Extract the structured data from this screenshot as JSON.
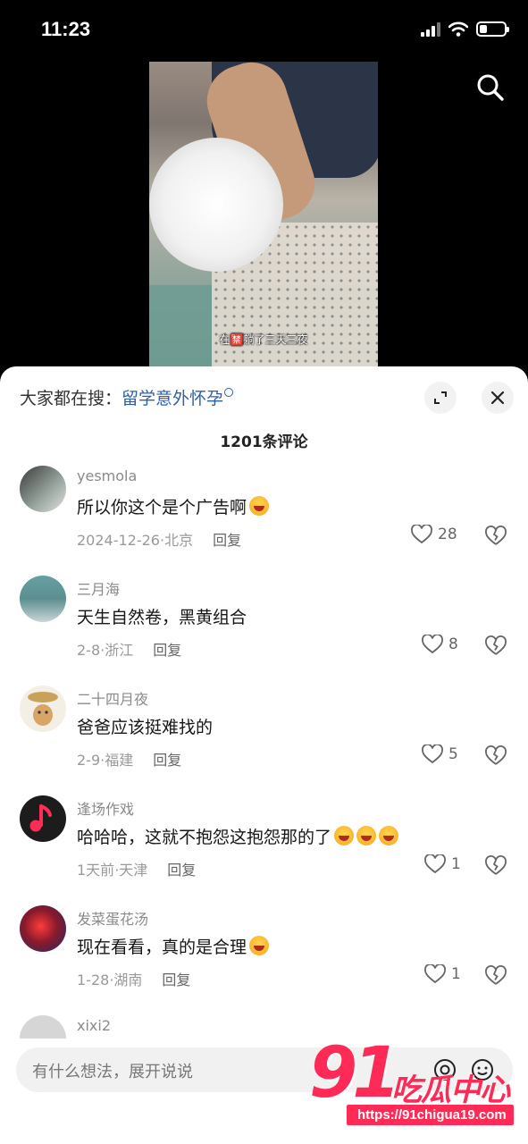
{
  "status_bar": {
    "time": "11:23",
    "battery_level": 0.3
  },
  "video": {
    "caption": "在🈲躺了三天三夜"
  },
  "comments_panel": {
    "search_prefix": "大家都在搜：",
    "search_term": "留学意外怀孕",
    "count_label": "1201条评论",
    "reply_label": "回复",
    "comments": [
      {
        "user": "yesmola",
        "text": "所以你这个是个广告啊",
        "emoji": "😂",
        "date": "2024-12-26",
        "location": "北京",
        "likes": "28"
      },
      {
        "user": "三月海",
        "text": "天生自然卷，黑黄组合",
        "emoji": "",
        "date": "2-8",
        "location": "浙江",
        "likes": "8"
      },
      {
        "user": "二十四月夜",
        "text": "爸爸应该挺难找的",
        "emoji": "",
        "date": "2-9",
        "location": "福建",
        "likes": "5"
      },
      {
        "user": "逢场作戏",
        "text": "哈哈哈，这就不抱怨这抱怨那的了",
        "emoji": "🤬🤬🤬",
        "date": "1天前",
        "location": "天津",
        "likes": "1"
      },
      {
        "user": "发菜蛋花汤",
        "text": "现在看看，真的是合理",
        "emoji": "🤬",
        "date": "1-28",
        "location": "湖南",
        "likes": "1"
      },
      {
        "user": "xixi2",
        "text": "",
        "emoji": "",
        "date": "",
        "location": "",
        "likes": ""
      }
    ]
  },
  "input_bar": {
    "placeholder": "有什么想法，展开说说"
  },
  "watermark": {
    "number": "91",
    "name": "吃瓜中心",
    "url": "https://91chigua19.com"
  },
  "colors": {
    "link": "#2d5fa8",
    "watermark": "#ff2a55"
  }
}
